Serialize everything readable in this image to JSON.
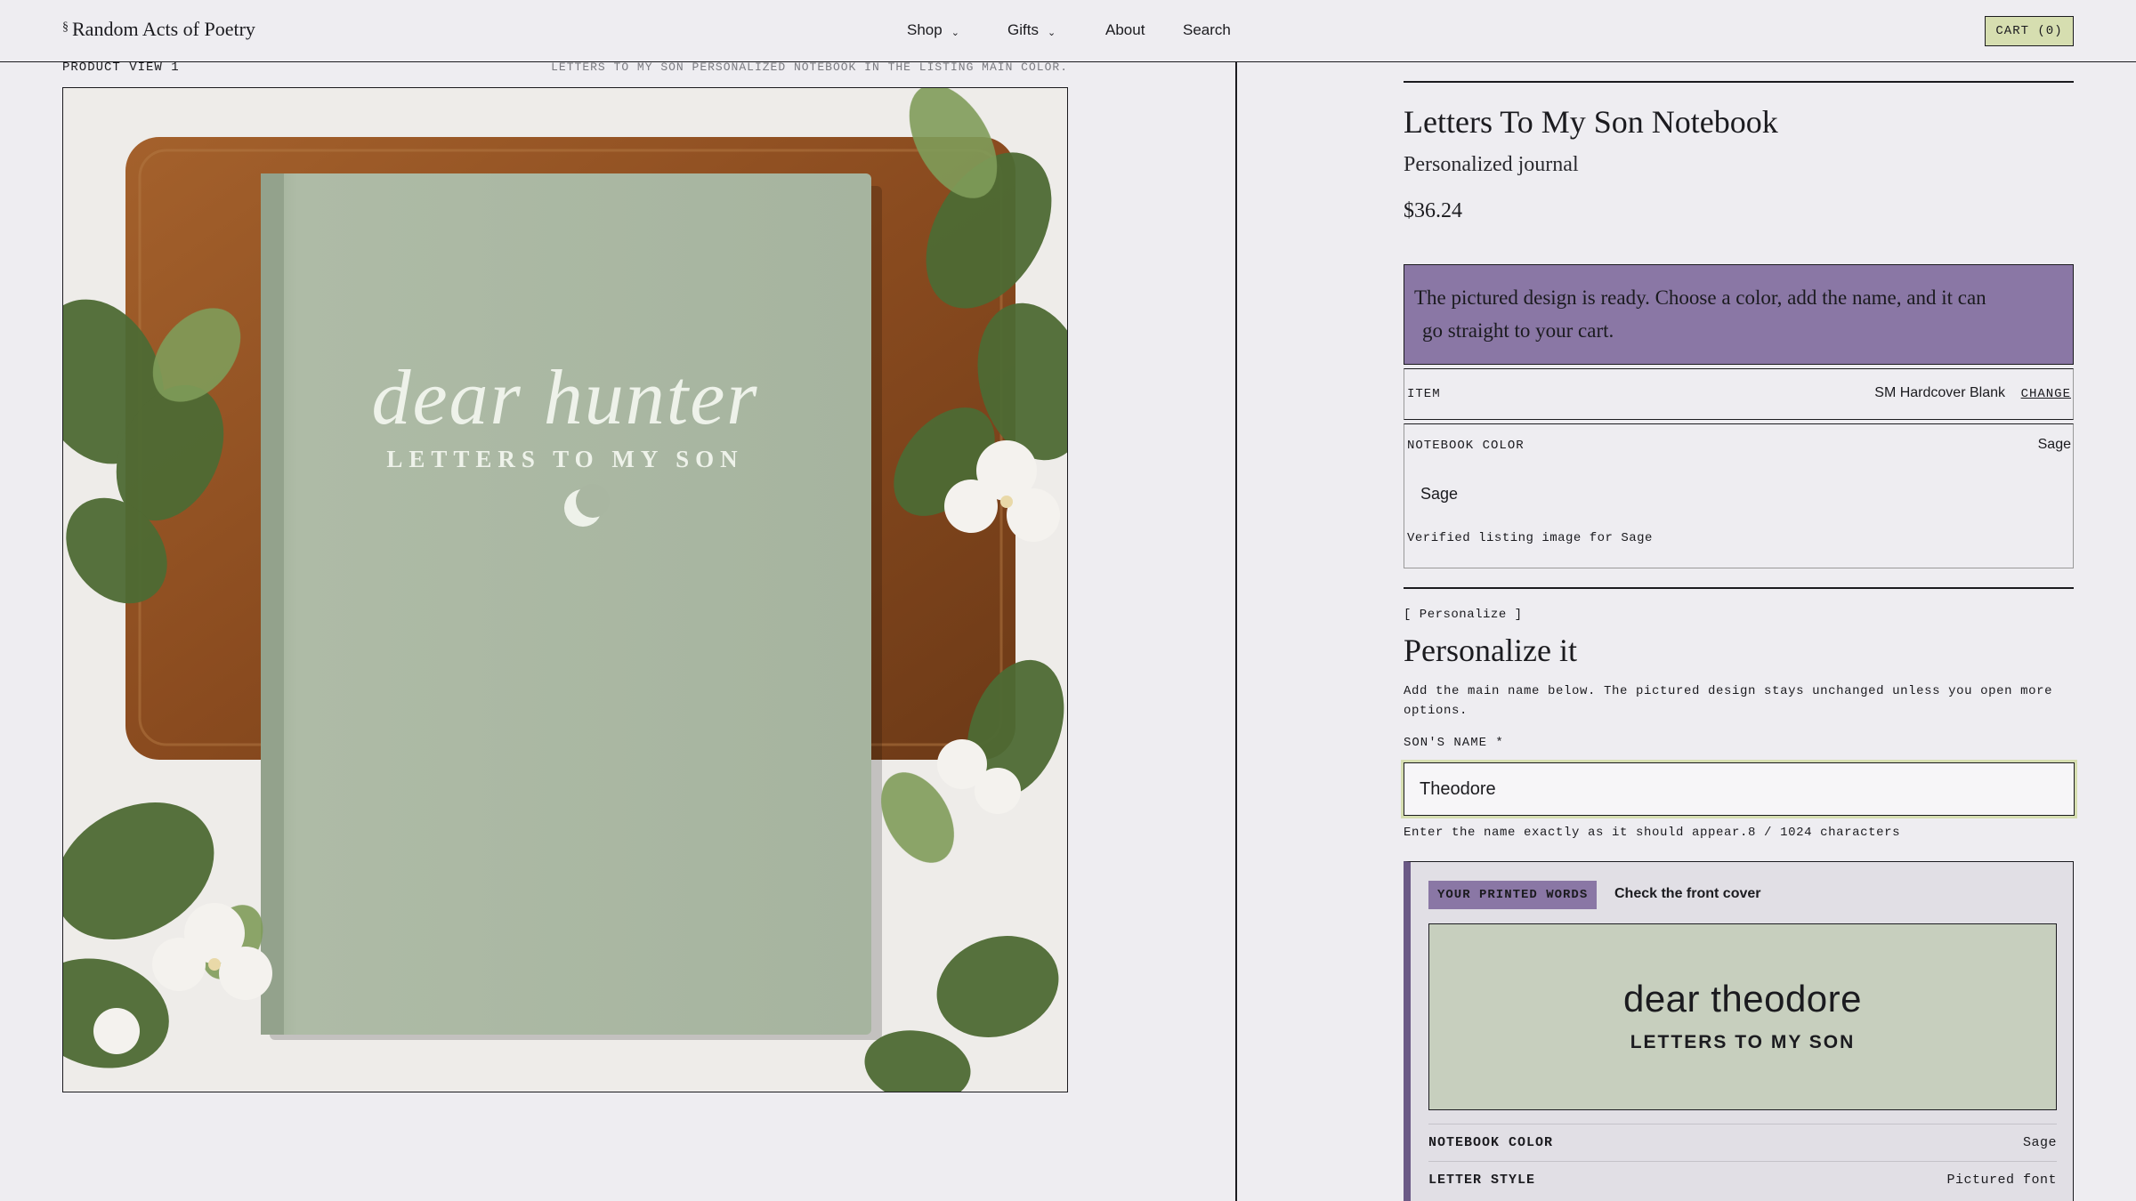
{
  "header": {
    "brand_mark": "§",
    "brand": "Random Acts of Poetry",
    "nav": [
      {
        "label": "Shop",
        "has_menu": true
      },
      {
        "label": "Gifts",
        "has_menu": true
      },
      {
        "label": "About",
        "has_menu": false
      },
      {
        "label": "Search",
        "has_menu": false
      }
    ],
    "chevron": "⌄",
    "cart_label": "CART (0)"
  },
  "gallery": {
    "view_label": "PRODUCT VIEW 1",
    "caption": "LETTERS TO MY SON PERSONALIZED NOTEBOOK IN THE LISTING MAIN COLOR.",
    "cover_script": "dear hunter",
    "cover_title": "LETTERS TO MY SON"
  },
  "product": {
    "title": "Letters To My Son Notebook",
    "subtitle": "Personalized journal",
    "price": "$36.24",
    "banner_line1": "The pictured design is ready. Choose a color, add the name, and it can",
    "banner_line2": "go straight to your cart.",
    "item_label": "ITEM",
    "item_value": "SM Hardcover Blank",
    "item_change": "CHANGE",
    "color_label": "NOTEBOOK COLOR",
    "color_value": "Sage",
    "color_selected": "Sage",
    "color_note": "Verified listing image for Sage"
  },
  "personalize": {
    "tag": "[ Personalize ]",
    "heading": "Personalize it",
    "help": "Add the main name below. The pictured design stays unchanged unless you open more options.",
    "name_label": "SON'S NAME *",
    "name_value": "Theodore",
    "hint": "Enter the name exactly as it should appear.8 / 1024 characters"
  },
  "printed": {
    "badge": "YOUR PRINTED WORDS",
    "note": "Check the front cover",
    "preview_name": "dear theodore",
    "preview_title": "LETTERS TO MY SON",
    "rows": [
      {
        "key": "NOTEBOOK COLOR",
        "value": "Sage"
      },
      {
        "key": "LETTER STYLE",
        "value": "Pictured font"
      }
    ]
  },
  "colors": {
    "background": "#eeedf1",
    "accent_purple": "#8a77a5",
    "accent_green": "#d6deb0",
    "sage": "#a9b7a0"
  }
}
